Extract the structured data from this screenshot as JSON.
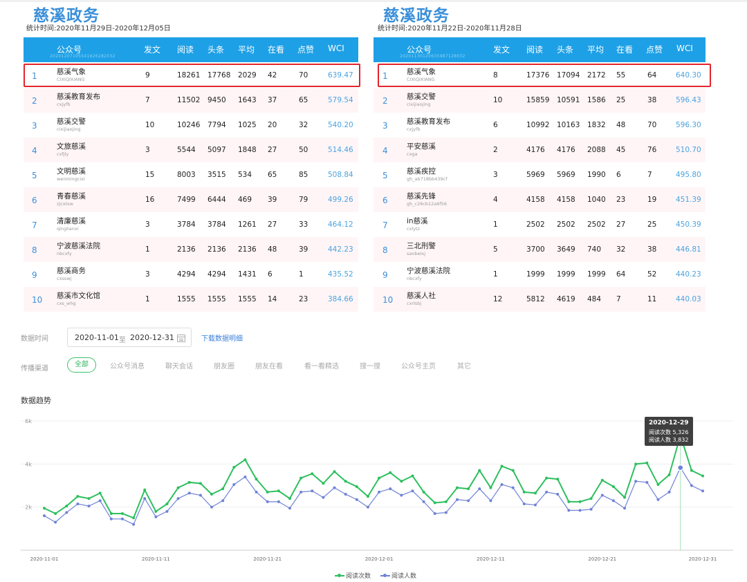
{
  "left": {
    "brand": "慈溪政务",
    "period": "统计时间:2020年11月29日-2020年12月05日",
    "headers": [
      "公众号",
      "发文",
      "阅读",
      "头条",
      "平均",
      "在看",
      "点赞",
      "WCI"
    ],
    "header_sub": "20201207105541626282032",
    "rows": [
      {
        "rank": "1",
        "name": "慈溪气象",
        "account": "CIXIQIXIANG",
        "posts": "9",
        "reads": "18261",
        "top": "17768",
        "avg": "2029",
        "looks": "42",
        "likes": "70",
        "wci": "639.47"
      },
      {
        "rank": "2",
        "name": "慈溪教育发布",
        "account": "cxjyfb",
        "posts": "7",
        "reads": "11502",
        "top": "9450",
        "avg": "1643",
        "looks": "37",
        "likes": "65",
        "wci": "579.54"
      },
      {
        "rank": "3",
        "name": "慈溪交警",
        "account": "cixijiaojing",
        "posts": "10",
        "reads": "10246",
        "top": "7794",
        "avg": "1025",
        "looks": "20",
        "likes": "32",
        "wci": "540.20"
      },
      {
        "rank": "4",
        "name": "文旅慈溪",
        "account": "cxfjly",
        "posts": "3",
        "reads": "5544",
        "top": "5097",
        "avg": "1848",
        "looks": "27",
        "likes": "50",
        "wci": "514.46"
      },
      {
        "rank": "5",
        "name": "文明慈溪",
        "account": "wenmingcixi",
        "posts": "15",
        "reads": "8003",
        "top": "3515",
        "avg": "534",
        "looks": "65",
        "likes": "85",
        "wci": "508.84"
      },
      {
        "rank": "6",
        "name": "青春慈溪",
        "account": "zjcxtsw",
        "posts": "16",
        "reads": "7499",
        "top": "6444",
        "avg": "469",
        "looks": "39",
        "likes": "79",
        "wci": "499.26"
      },
      {
        "rank": "7",
        "name": "清廉慈溪",
        "account": "qinglianxi",
        "posts": "3",
        "reads": "3784",
        "top": "3784",
        "avg": "1261",
        "looks": "27",
        "likes": "33",
        "wci": "464.12"
      },
      {
        "rank": "8",
        "name": "宁波慈溪法院",
        "account": "nbcxfy",
        "posts": "1",
        "reads": "2136",
        "top": "2136",
        "avg": "2136",
        "looks": "48",
        "likes": "39",
        "wci": "442.23"
      },
      {
        "rank": "9",
        "name": "慈溪商务",
        "account": "cxsswj",
        "posts": "3",
        "reads": "4294",
        "top": "4294",
        "avg": "1431",
        "looks": "6",
        "likes": "1",
        "wci": "435.52"
      },
      {
        "rank": "10",
        "name": "慈溪市文化馆",
        "account": "cxs_whg",
        "posts": "1",
        "reads": "1555",
        "top": "1555",
        "avg": "1555",
        "looks": "14",
        "likes": "23",
        "wci": "384.66"
      }
    ]
  },
  "right": {
    "brand": "慈溪政务",
    "period": "统计时间:2020年11月22日-2020年11月28日",
    "headers": [
      "公众号",
      "发文",
      "阅读",
      "头条",
      "平均",
      "在看",
      "点赞",
      "WCI"
    ],
    "header_sub": "20201130120635987128032",
    "rows": [
      {
        "rank": "1",
        "name": "慈溪气象",
        "account": "CIXIQIXIANG",
        "posts": "8",
        "reads": "17376",
        "top": "17094",
        "avg": "2172",
        "looks": "55",
        "likes": "64",
        "wci": "640.30"
      },
      {
        "rank": "2",
        "name": "慈溪交警",
        "account": "cixijiaojing",
        "posts": "10",
        "reads": "15859",
        "top": "10591",
        "avg": "1586",
        "looks": "25",
        "likes": "38",
        "wci": "596.43"
      },
      {
        "rank": "3",
        "name": "慈溪教育发布",
        "account": "cxjyfb",
        "posts": "6",
        "reads": "10992",
        "top": "10163",
        "avg": "1832",
        "looks": "48",
        "likes": "70",
        "wci": "596.30"
      },
      {
        "rank": "4",
        "name": "平安慈溪",
        "account": "cxga",
        "posts": "2",
        "reads": "4176",
        "top": "4176",
        "avg": "2088",
        "looks": "45",
        "likes": "76",
        "wci": "510.70"
      },
      {
        "rank": "5",
        "name": "慈溪疾控",
        "account": "gh_ab718bb439cf",
        "posts": "3",
        "reads": "5969",
        "top": "5969",
        "avg": "1990",
        "looks": "6",
        "likes": "7",
        "wci": "495.80"
      },
      {
        "rank": "6",
        "name": "慈溪先锋",
        "account": "gh_c26cb12a6f56",
        "posts": "4",
        "reads": "4158",
        "top": "4158",
        "avg": "1040",
        "looks": "23",
        "likes": "19",
        "wci": "451.39"
      },
      {
        "rank": "7",
        "name": "in慈溪",
        "account": "cxlytz",
        "posts": "1",
        "reads": "2502",
        "top": "2502",
        "avg": "2502",
        "looks": "27",
        "likes": "25",
        "wci": "450.39"
      },
      {
        "rank": "8",
        "name": "三北刑警",
        "account": "sanbeixj",
        "posts": "5",
        "reads": "3700",
        "top": "3649",
        "avg": "740",
        "looks": "32",
        "likes": "38",
        "wci": "446.81"
      },
      {
        "rank": "9",
        "name": "宁波慈溪法院",
        "account": "nbcxfy",
        "posts": "1",
        "reads": "1999",
        "top": "1999",
        "avg": "1999",
        "looks": "64",
        "likes": "52",
        "wci": "440.23"
      },
      {
        "rank": "10",
        "name": "慈溪人社",
        "account": "cxrlsbj",
        "posts": "12",
        "reads": "5812",
        "top": "4619",
        "avg": "484",
        "looks": "7",
        "likes": "11",
        "wci": "440.03"
      }
    ]
  },
  "filters": {
    "date_label": "数据时间",
    "date_start": "2020-11-01",
    "date_sep": "至",
    "date_end": "2020-12-31",
    "download_link": "下载数据明细",
    "channel_label": "传播渠道",
    "channels": [
      "全部",
      "公众号消息",
      "聊天会话",
      "朋友圈",
      "朋友在看",
      "看一看精选",
      "搜一搜",
      "公众号主页",
      "其它"
    ],
    "active_channel": "全部"
  },
  "trend_title": "数据趋势",
  "tooltip": {
    "date": "2020-12-29",
    "line1": "阅读次数 5,326",
    "line2": "阅读人数 3,832"
  },
  "chart_data": {
    "type": "line",
    "x_start": "2020-11-01",
    "x_end": "2020-12-31",
    "x_ticks": [
      "2020-11-01",
      "2020-11-11",
      "2020-11-21",
      "2020-12-01",
      "2020-12-11",
      "2020-12-21",
      "2020-12-31"
    ],
    "y_ticks": [
      "2k",
      "4k",
      "6k"
    ],
    "ylim": [
      0,
      6000
    ],
    "legend_position": "bottom",
    "series": [
      {
        "name": "阅读次数",
        "color": "#2dbf5e",
        "values": [
          1950,
          1700,
          2050,
          2500,
          2400,
          2650,
          1700,
          1700,
          1500,
          2800,
          1800,
          2150,
          2900,
          3150,
          3100,
          2600,
          2850,
          3850,
          4200,
          3300,
          2700,
          2750,
          2400,
          3350,
          3550,
          3100,
          3650,
          3200,
          2950,
          2500,
          3350,
          3600,
          3200,
          3450,
          2700,
          2200,
          2250,
          2900,
          2850,
          3700,
          2900,
          3900,
          3700,
          2700,
          2650,
          3350,
          3300,
          2250,
          2250,
          2400,
          3250,
          2950,
          2450,
          4000,
          4050,
          3050,
          3500,
          5326,
          3700,
          3450
        ]
      },
      {
        "name": "阅读人数",
        "color": "#6f82d6",
        "values": [
          1600,
          1300,
          1750,
          2150,
          2050,
          2300,
          1450,
          1450,
          1200,
          2400,
          1550,
          1800,
          2400,
          2650,
          2550,
          2000,
          2300,
          3050,
          3400,
          2700,
          2250,
          2250,
          1950,
          2700,
          2750,
          2450,
          2900,
          2600,
          2350,
          2000,
          2700,
          2850,
          2550,
          2750,
          2250,
          1700,
          1750,
          2350,
          2300,
          2850,
          2300,
          3050,
          2900,
          2150,
          2100,
          2700,
          2600,
          1850,
          1850,
          1900,
          2550,
          2300,
          1950,
          3200,
          3150,
          2350,
          2700,
          3832,
          3000,
          2750
        ]
      }
    ]
  }
}
